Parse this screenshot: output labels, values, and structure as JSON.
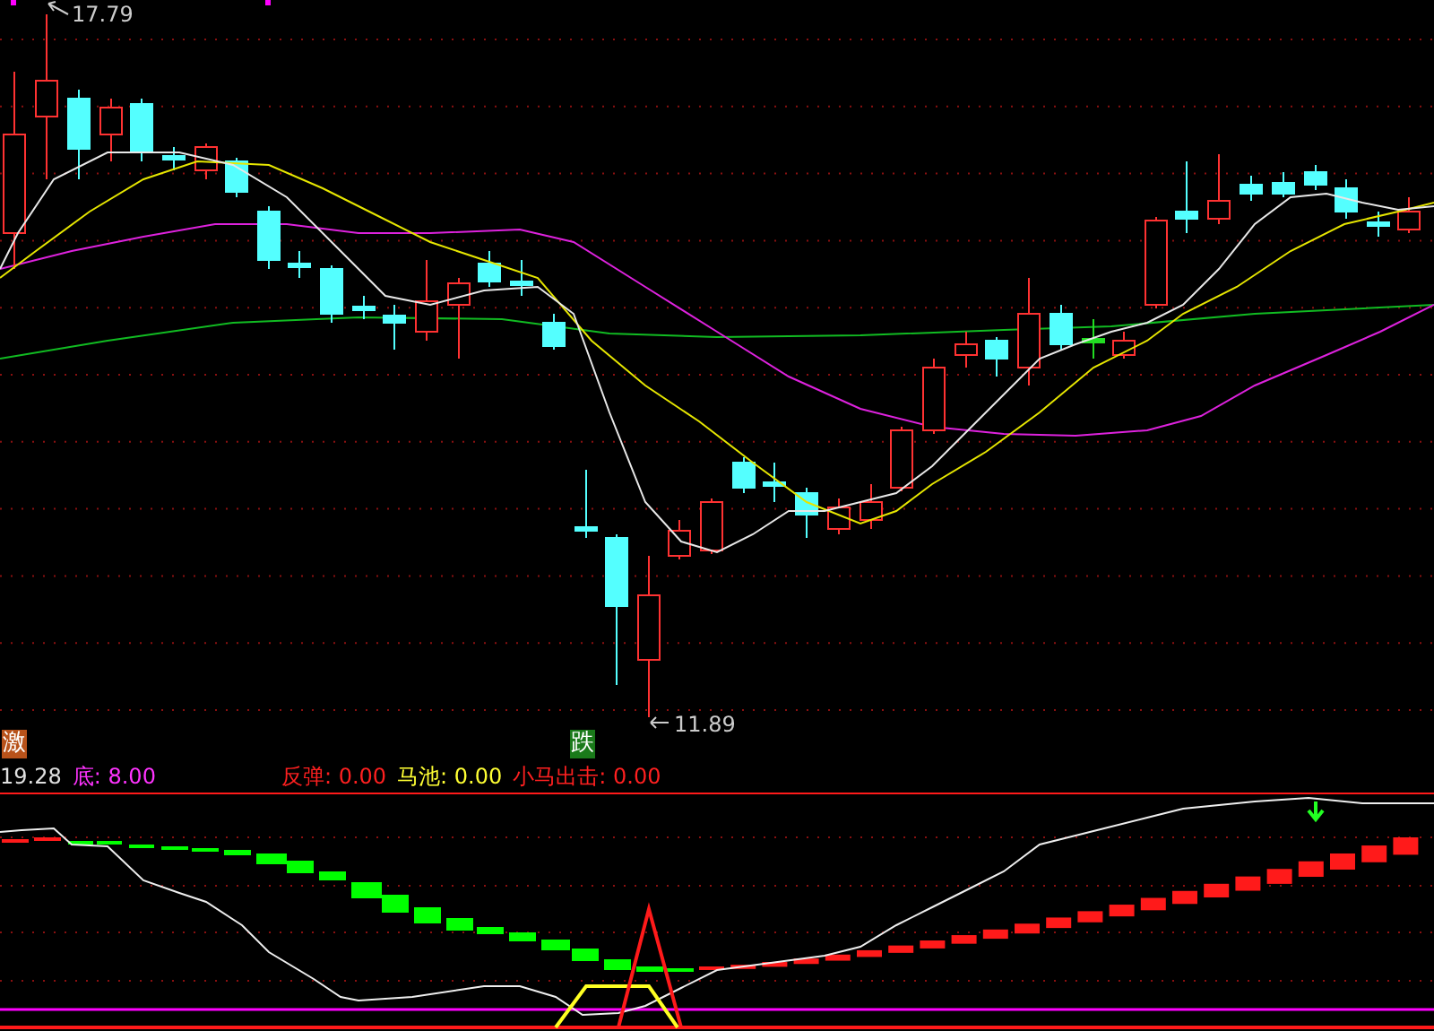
{
  "price_chart": {
    "high_label": "17.79",
    "low_label": "11.89",
    "markers": [
      {
        "text": "激",
        "color": "#b8521a"
      },
      {
        "text": "跌",
        "color": "#1a7a1a"
      }
    ]
  },
  "indicator_header": [
    {
      "value": "19.28",
      "color": "#e0e0e0"
    },
    {
      "label": "底:",
      "value": "8.00",
      "color": "#ff33ff"
    },
    {
      "label": "反弹:",
      "value": "0.00",
      "color": "#ff2020"
    },
    {
      "label": "马池:",
      "value": "0.00",
      "color": "#ffff33"
    },
    {
      "label": "小马出击:",
      "value": "0.00",
      "color": "#ff2020"
    }
  ]
}
